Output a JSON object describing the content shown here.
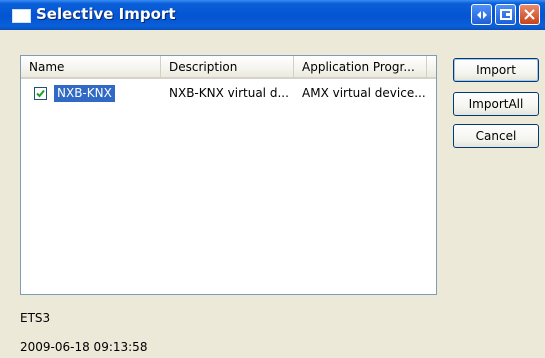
{
  "window": {
    "title": "Selective Import"
  },
  "listview": {
    "columns": [
      "Name",
      "Description",
      "Application Progr..."
    ],
    "rows": [
      {
        "checked": true,
        "name": "NXB-KNX",
        "description": "NXB-KNX virtual d...",
        "application": "AMX virtual device..."
      }
    ]
  },
  "buttons": {
    "import": "Import",
    "import_all": "ImportAll",
    "cancel": "Cancel"
  },
  "footer": {
    "source": "ETS3",
    "timestamp": "2009-06-18 09:13:58"
  }
}
